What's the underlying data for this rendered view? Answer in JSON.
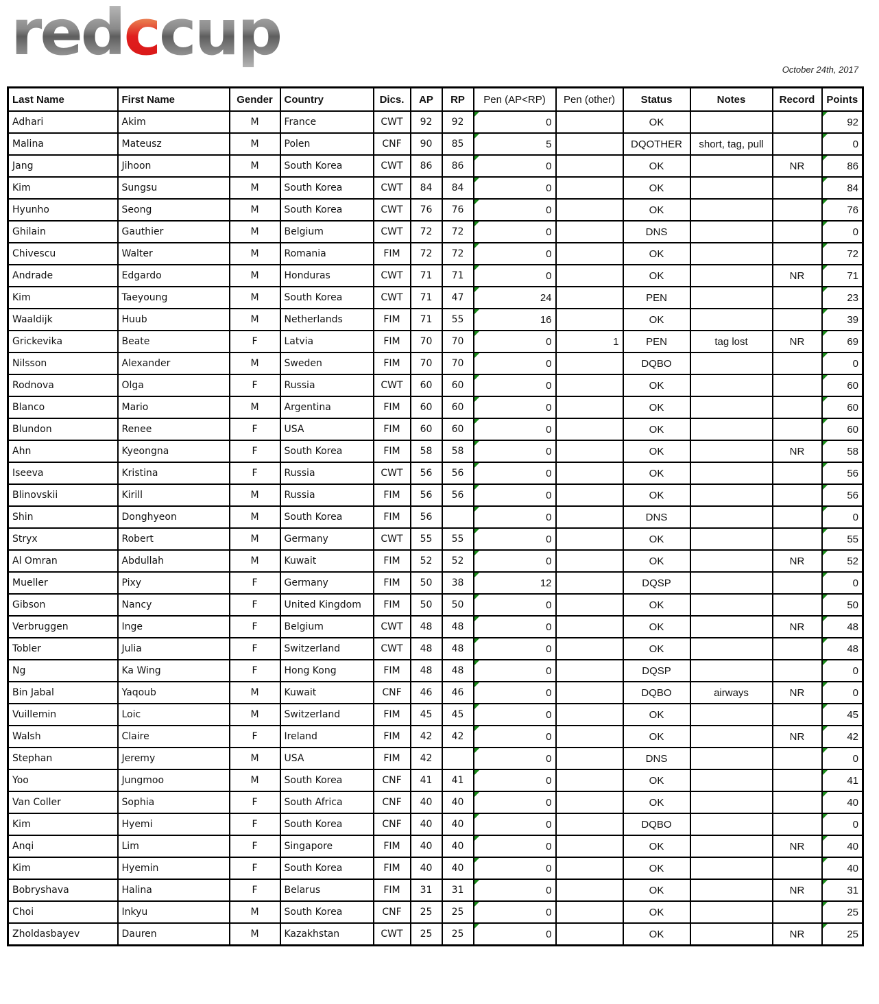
{
  "header": {
    "logo_part1": "red",
    "logo_part2": "c",
    "logo_part3": "cup",
    "date": "October 24th, 2017"
  },
  "colors": {
    "logo_red": "#e01e1e",
    "logo_grey": "#8a8a8a",
    "comment_flag": "#1a8a1a"
  },
  "table": {
    "columns": [
      "Last Name",
      "First Name",
      "Gender",
      "Country",
      "Dics.",
      "AP",
      "RP",
      "Pen (AP<RP)",
      "Pen (other)",
      "Status",
      "Notes",
      "Record",
      "Points"
    ],
    "rows": [
      {
        "last": "Adhari",
        "first": "Akim",
        "gender": "M",
        "country": "France",
        "disc": "CWT",
        "ap": "92",
        "rp": "92",
        "pen_ap": "0",
        "pen_other": "",
        "status": "OK",
        "notes": "",
        "record": "",
        "points": "92"
      },
      {
        "last": "Malina",
        "first": "Mateusz",
        "gender": "M",
        "country": "Polen",
        "disc": "CNF",
        "ap": "90",
        "rp": "85",
        "pen_ap": "5",
        "pen_other": "",
        "status": "DQOTHER",
        "notes": "short, tag, pull",
        "record": "",
        "points": "0"
      },
      {
        "last": "Jang",
        "first": "Jihoon",
        "gender": "M",
        "country": "South Korea",
        "disc": "CWT",
        "ap": "86",
        "rp": "86",
        "pen_ap": "0",
        "pen_other": "",
        "status": "OK",
        "notes": "",
        "record": "NR",
        "points": "86"
      },
      {
        "last": "Kim",
        "first": "Sungsu",
        "gender": "M",
        "country": "South Korea",
        "disc": "CWT",
        "ap": "84",
        "rp": "84",
        "pen_ap": "0",
        "pen_other": "",
        "status": "OK",
        "notes": "",
        "record": "",
        "points": "84"
      },
      {
        "last": "Hyunho",
        "first": "Seong",
        "gender": "M",
        "country": "South Korea",
        "disc": "CWT",
        "ap": "76",
        "rp": "76",
        "pen_ap": "0",
        "pen_other": "",
        "status": "OK",
        "notes": "",
        "record": "",
        "points": "76"
      },
      {
        "last": "Ghilain",
        "first": "Gauthier",
        "gender": "M",
        "country": "Belgium",
        "disc": "CWT",
        "ap": "72",
        "rp": "72",
        "pen_ap": "0",
        "pen_other": "",
        "status": "DNS",
        "notes": "",
        "record": "",
        "points": "0"
      },
      {
        "last": "Chivescu",
        "first": "Walter",
        "gender": "M",
        "country": "Romania",
        "disc": "FIM",
        "ap": "72",
        "rp": "72",
        "pen_ap": "0",
        "pen_other": "",
        "status": "OK",
        "notes": "",
        "record": "",
        "points": "72"
      },
      {
        "last": "Andrade",
        "first": "Edgardo",
        "gender": "M",
        "country": "Honduras",
        "disc": "CWT",
        "ap": "71",
        "rp": "71",
        "pen_ap": "0",
        "pen_other": "",
        "status": "OK",
        "notes": "",
        "record": "NR",
        "points": "71"
      },
      {
        "last": "Kim",
        "first": "Taeyoung",
        "gender": "M",
        "country": "South Korea",
        "disc": "CWT",
        "ap": "71",
        "rp": "47",
        "pen_ap": "24",
        "pen_other": "",
        "status": "PEN",
        "notes": "",
        "record": "",
        "points": "23"
      },
      {
        "last": "Waaldijk",
        "first": "Huub",
        "gender": "M",
        "country": "Netherlands",
        "disc": "FIM",
        "ap": "71",
        "rp": "55",
        "pen_ap": "16",
        "pen_other": "",
        "status": "OK",
        "notes": "",
        "record": "",
        "points": "39"
      },
      {
        "last": "Grickevika",
        "first": "Beate",
        "gender": "F",
        "country": "Latvia",
        "disc": "FIM",
        "ap": "70",
        "rp": "70",
        "pen_ap": "0",
        "pen_other": "1",
        "status": "PEN",
        "notes": "tag lost",
        "record": "NR",
        "points": "69"
      },
      {
        "last": "Nilsson",
        "first": "Alexander",
        "gender": "M",
        "country": "Sweden",
        "disc": "FIM",
        "ap": "70",
        "rp": "70",
        "pen_ap": "0",
        "pen_other": "",
        "status": "DQBO",
        "notes": "",
        "record": "",
        "points": "0"
      },
      {
        "last": "Rodnova",
        "first": "Olga",
        "gender": "F",
        "country": "Russia",
        "disc": "CWT",
        "ap": "60",
        "rp": "60",
        "pen_ap": "0",
        "pen_other": "",
        "status": "OK",
        "notes": "",
        "record": "",
        "points": "60"
      },
      {
        "last": "Blanco",
        "first": "Mario",
        "gender": "M",
        "country": "Argentina",
        "disc": "FIM",
        "ap": "60",
        "rp": "60",
        "pen_ap": "0",
        "pen_other": "",
        "status": "OK",
        "notes": "",
        "record": "",
        "points": "60"
      },
      {
        "last": "Blundon",
        "first": "Renee",
        "gender": "F",
        "country": "USA",
        "disc": "FIM",
        "ap": "60",
        "rp": "60",
        "pen_ap": "0",
        "pen_other": "",
        "status": "OK",
        "notes": "",
        "record": "",
        "points": "60"
      },
      {
        "last": "Ahn",
        "first": "Kyeongna",
        "gender": "F",
        "country": "South Korea",
        "disc": "FIM",
        "ap": "58",
        "rp": "58",
        "pen_ap": "0",
        "pen_other": "",
        "status": "OK",
        "notes": "",
        "record": "NR",
        "points": "58"
      },
      {
        "last": "Iseeva",
        "first": "Kristina",
        "gender": "F",
        "country": "Russia",
        "disc": "CWT",
        "ap": "56",
        "rp": "56",
        "pen_ap": "0",
        "pen_other": "",
        "status": "OK",
        "notes": "",
        "record": "",
        "points": "56"
      },
      {
        "last": "Blinovskii",
        "first": "Kirill",
        "gender": "M",
        "country": "Russia",
        "disc": "FIM",
        "ap": "56",
        "rp": "56",
        "pen_ap": "0",
        "pen_other": "",
        "status": "OK",
        "notes": "",
        "record": "",
        "points": "56"
      },
      {
        "last": "Shin",
        "first": "Donghyeon",
        "gender": "M",
        "country": "South Korea",
        "disc": "FIM",
        "ap": "56",
        "rp": "",
        "pen_ap": "0",
        "pen_other": "",
        "status": "DNS",
        "notes": "",
        "record": "",
        "points": "0"
      },
      {
        "last": "Stryx",
        "first": "Robert",
        "gender": "M",
        "country": "Germany",
        "disc": "CWT",
        "ap": "55",
        "rp": "55",
        "pen_ap": "0",
        "pen_other": "",
        "status": "OK",
        "notes": "",
        "record": "",
        "points": "55"
      },
      {
        "last": "Al Omran",
        "first": "Abdullah",
        "gender": "M",
        "country": "Kuwait",
        "disc": "FIM",
        "ap": "52",
        "rp": "52",
        "pen_ap": "0",
        "pen_other": "",
        "status": "OK",
        "notes": "",
        "record": "NR",
        "points": "52"
      },
      {
        "last": "Mueller",
        "first": "Pixy",
        "gender": "F",
        "country": "Germany",
        "disc": "FIM",
        "ap": "50",
        "rp": "38",
        "pen_ap": "12",
        "pen_other": "",
        "status": "DQSP",
        "notes": "",
        "record": "",
        "points": "0"
      },
      {
        "last": "Gibson",
        "first": "Nancy",
        "gender": "F",
        "country": "United Kingdom",
        "disc": "FIM",
        "ap": "50",
        "rp": "50",
        "pen_ap": "0",
        "pen_other": "",
        "status": "OK",
        "notes": "",
        "record": "",
        "points": "50"
      },
      {
        "last": "Verbruggen",
        "first": "Inge",
        "gender": "F",
        "country": "Belgium",
        "disc": "CWT",
        "ap": "48",
        "rp": "48",
        "pen_ap": "0",
        "pen_other": "",
        "status": "OK",
        "notes": "",
        "record": "NR",
        "points": "48"
      },
      {
        "last": "Tobler",
        "first": "Julia",
        "gender": "F",
        "country": "Switzerland",
        "disc": "CWT",
        "ap": "48",
        "rp": "48",
        "pen_ap": "0",
        "pen_other": "",
        "status": "OK",
        "notes": "",
        "record": "",
        "points": "48"
      },
      {
        "last": "Ng",
        "first": "Ka Wing",
        "gender": "F",
        "country": "Hong Kong",
        "disc": "FIM",
        "ap": "48",
        "rp": "48",
        "pen_ap": "0",
        "pen_other": "",
        "status": "DQSP",
        "notes": "",
        "record": "",
        "points": "0"
      },
      {
        "last": "Bin Jabal",
        "first": "Yaqoub",
        "gender": "M",
        "country": "Kuwait",
        "disc": "CNF",
        "ap": "46",
        "rp": "46",
        "pen_ap": "0",
        "pen_other": "",
        "status": "DQBO",
        "notes": "airways",
        "record": "NR",
        "points": "0"
      },
      {
        "last": "Vuillemin",
        "first": "Loic",
        "gender": "M",
        "country": "Switzerland",
        "disc": "FIM",
        "ap": "45",
        "rp": "45",
        "pen_ap": "0",
        "pen_other": "",
        "status": "OK",
        "notes": "",
        "record": "",
        "points": "45"
      },
      {
        "last": "Walsh",
        "first": "Claire",
        "gender": "F",
        "country": "Ireland",
        "disc": "FIM",
        "ap": "42",
        "rp": "42",
        "pen_ap": "0",
        "pen_other": "",
        "status": "OK",
        "notes": "",
        "record": "NR",
        "points": "42"
      },
      {
        "last": "Stephan",
        "first": "Jeremy",
        "gender": "M",
        "country": "USA",
        "disc": "FIM",
        "ap": "42",
        "rp": "",
        "pen_ap": "0",
        "pen_other": "",
        "status": "DNS",
        "notes": "",
        "record": "",
        "points": "0"
      },
      {
        "last": "Yoo",
        "first": "Jungmoo",
        "gender": "M",
        "country": "South Korea",
        "disc": "CNF",
        "ap": "41",
        "rp": "41",
        "pen_ap": "0",
        "pen_other": "",
        "status": "OK",
        "notes": "",
        "record": "",
        "points": "41"
      },
      {
        "last": "Van Coller",
        "first": "Sophia",
        "gender": "F",
        "country": "South Africa",
        "disc": "CNF",
        "ap": "40",
        "rp": "40",
        "pen_ap": "0",
        "pen_other": "",
        "status": "OK",
        "notes": "",
        "record": "",
        "points": "40"
      },
      {
        "last": "Kim",
        "first": "Hyemi",
        "gender": "F",
        "country": "South Korea",
        "disc": "CNF",
        "ap": "40",
        "rp": "40",
        "pen_ap": "0",
        "pen_other": "",
        "status": "DQBO",
        "notes": "",
        "record": "",
        "points": "0"
      },
      {
        "last": "Anqi",
        "first": "Lim",
        "gender": "F",
        "country": "Singapore",
        "disc": "FIM",
        "ap": "40",
        "rp": "40",
        "pen_ap": "0",
        "pen_other": "",
        "status": "OK",
        "notes": "",
        "record": "NR",
        "points": "40"
      },
      {
        "last": "Kim",
        "first": "Hyemin",
        "gender": "F",
        "country": "South Korea",
        "disc": "FIM",
        "ap": "40",
        "rp": "40",
        "pen_ap": "0",
        "pen_other": "",
        "status": "OK",
        "notes": "",
        "record": "",
        "points": "40"
      },
      {
        "last": "Bobryshava",
        "first": "Halina",
        "gender": "F",
        "country": "Belarus",
        "disc": "FIM",
        "ap": "31",
        "rp": "31",
        "pen_ap": "0",
        "pen_other": "",
        "status": "OK",
        "notes": "",
        "record": "NR",
        "points": "31"
      },
      {
        "last": "Choi",
        "first": "Inkyu",
        "gender": "M",
        "country": "South Korea",
        "disc": "CNF",
        "ap": "25",
        "rp": "25",
        "pen_ap": "0",
        "pen_other": "",
        "status": "OK",
        "notes": "",
        "record": "",
        "points": "25"
      },
      {
        "last": "Zholdasbayev",
        "first": "Dauren",
        "gender": "M",
        "country": "Kazakhstan",
        "disc": "CWT",
        "ap": "25",
        "rp": "25",
        "pen_ap": "0",
        "pen_other": "",
        "status": "OK",
        "notes": "",
        "record": "NR",
        "points": "25"
      }
    ]
  }
}
